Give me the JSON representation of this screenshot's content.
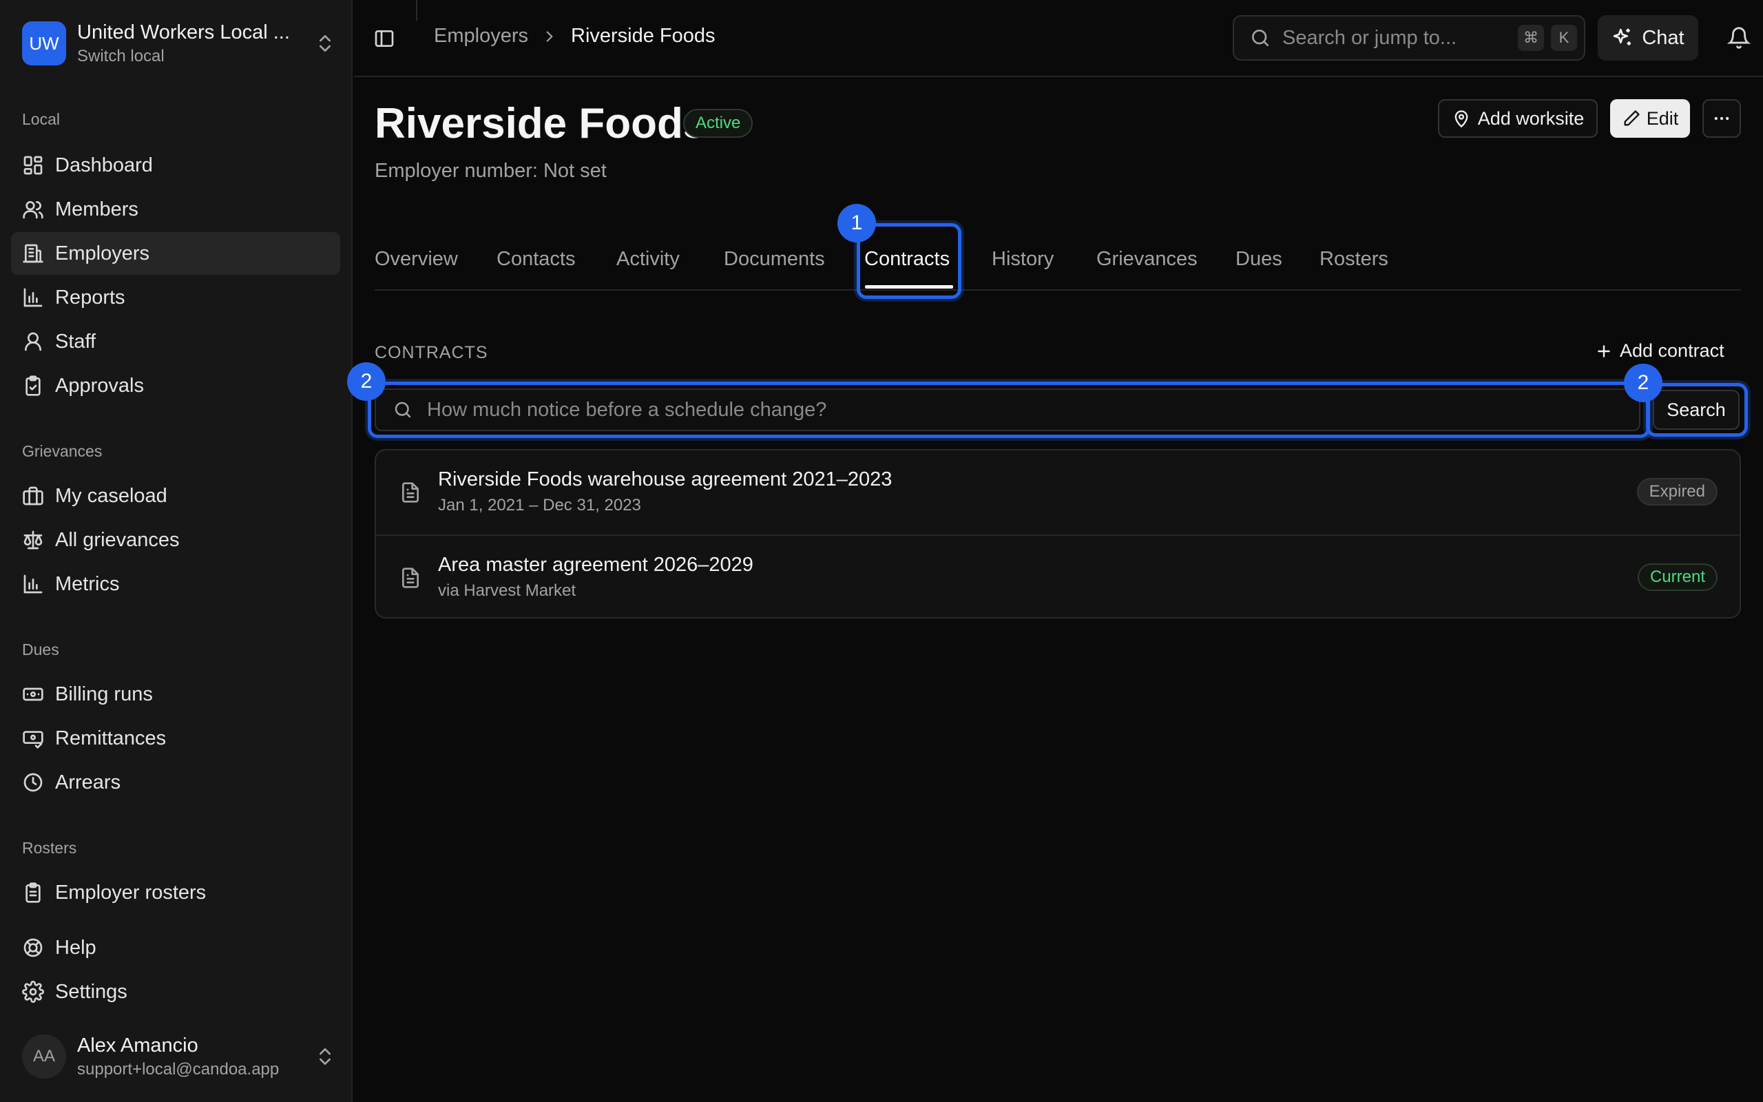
{
  "org": {
    "initials": "UW",
    "name": "United Workers Local ...",
    "switch_label": "Switch local"
  },
  "sidebar": {
    "sections": [
      {
        "label": "Local",
        "items": [
          "Dashboard",
          "Members",
          "Employers",
          "Reports",
          "Staff",
          "Approvals"
        ]
      },
      {
        "label": "Grievances",
        "items": [
          "My caseload",
          "All grievances",
          "Metrics"
        ]
      },
      {
        "label": "Dues",
        "items": [
          "Billing runs",
          "Remittances",
          "Arrears"
        ]
      },
      {
        "label": "Rosters",
        "items": [
          "Employer rosters"
        ]
      }
    ],
    "bottom": [
      "Help",
      "Settings"
    ],
    "active": "Employers"
  },
  "user": {
    "initials": "AA",
    "name": "Alex Amancio",
    "email": "support+local@candoa.app"
  },
  "topbar": {
    "breadcrumb": [
      "Employers",
      "Riverside Foods"
    ],
    "search_placeholder": "Search or jump to...",
    "shortcut_keys": [
      "⌘",
      "K"
    ],
    "chat_label": "Chat"
  },
  "employer": {
    "name": "Riverside Foods",
    "status": "Active",
    "employer_number": "Employer number: Not set",
    "actions": {
      "add_worksite": "Add worksite",
      "edit": "Edit"
    }
  },
  "tabs": [
    "Overview",
    "Contacts",
    "Activity",
    "Documents",
    "Contracts",
    "History",
    "Grievances",
    "Dues",
    "Rosters"
  ],
  "active_tab": "Contracts",
  "contracts": {
    "section_label": "CONTRACTS",
    "add_label": "Add contract",
    "search_placeholder": "How much notice before a schedule change?",
    "search_button": "Search",
    "items": [
      {
        "title": "Riverside Foods warehouse agreement 2021–2023",
        "subtitle": "Jan 1, 2021 – Dec 31, 2023",
        "status": "Expired"
      },
      {
        "title": "Area master agreement 2026–2029",
        "subtitle": "via Harvest Market",
        "status": "Current"
      }
    ]
  },
  "annotations": {
    "tab_marker": "1",
    "search_marker": "2",
    "search_button_marker": "2"
  },
  "colors": {
    "accent": "#2563eb",
    "active_green": "#4ade80",
    "background": "#0a0a0a",
    "sidebar": "#171717"
  }
}
